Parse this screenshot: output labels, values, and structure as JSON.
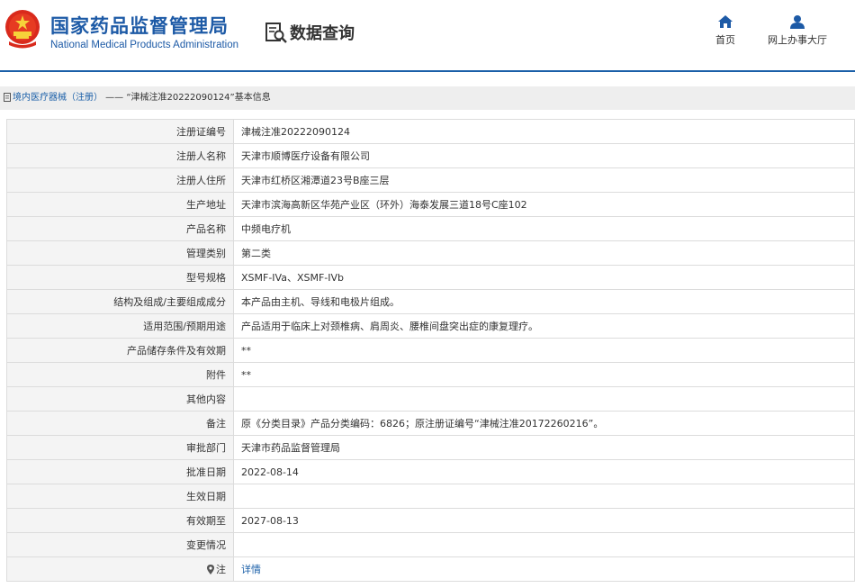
{
  "header": {
    "site_title": "国家药品监督管理局",
    "site_subtitle": "National Medical Products Administration",
    "query_label": "数据查询",
    "nav": [
      {
        "label": "首页",
        "icon": "home-icon"
      },
      {
        "label": "网上办事大厅",
        "icon": "user-icon"
      }
    ],
    "brand_color": "#1d5aa6"
  },
  "breadcrumb": {
    "section": "境内医疗器械（注册）",
    "separator": " —— ",
    "current": "“津械注准20222090124”",
    "suffix": "基本信息"
  },
  "table": {
    "rows": [
      {
        "label": "注册证编号",
        "value": "津械注准20222090124"
      },
      {
        "label": "注册人名称",
        "value": "天津市顺博医疗设备有限公司"
      },
      {
        "label": "注册人住所",
        "value": "天津市红桥区湘潭道23号B座三层"
      },
      {
        "label": "生产地址",
        "value": "天津市滨海高新区华苑产业区（环外）海泰发展三道18号C座102"
      },
      {
        "label": "产品名称",
        "value": "中频电疗机"
      },
      {
        "label": "管理类别",
        "value": "第二类"
      },
      {
        "label": "型号规格",
        "value": "XSMF-IVa、XSMF-IVb"
      },
      {
        "label": "结构及组成/主要组成成分",
        "value": "本产品由主机、导线和电极片组成。"
      },
      {
        "label": "适用范围/预期用途",
        "value": "产品适用于临床上对颈椎病、肩周炎、腰椎间盘突出症的康复理疗。"
      },
      {
        "label": "产品储存条件及有效期",
        "value": "**"
      },
      {
        "label": "附件",
        "value": "**"
      },
      {
        "label": "其他内容",
        "value": ""
      },
      {
        "label": "备注",
        "value": "原《分类目录》产品分类编码：6826；原注册证编号“津械注准20172260216”。"
      },
      {
        "label": "审批部门",
        "value": "天津市药品监督管理局"
      },
      {
        "label": "批准日期",
        "value": "2022-08-14"
      },
      {
        "label": "生效日期",
        "value": ""
      },
      {
        "label": "有效期至",
        "value": "2027-08-13"
      },
      {
        "label": "变更情况",
        "value": ""
      }
    ],
    "note_row": {
      "label": "注",
      "link_text": "详情"
    }
  }
}
